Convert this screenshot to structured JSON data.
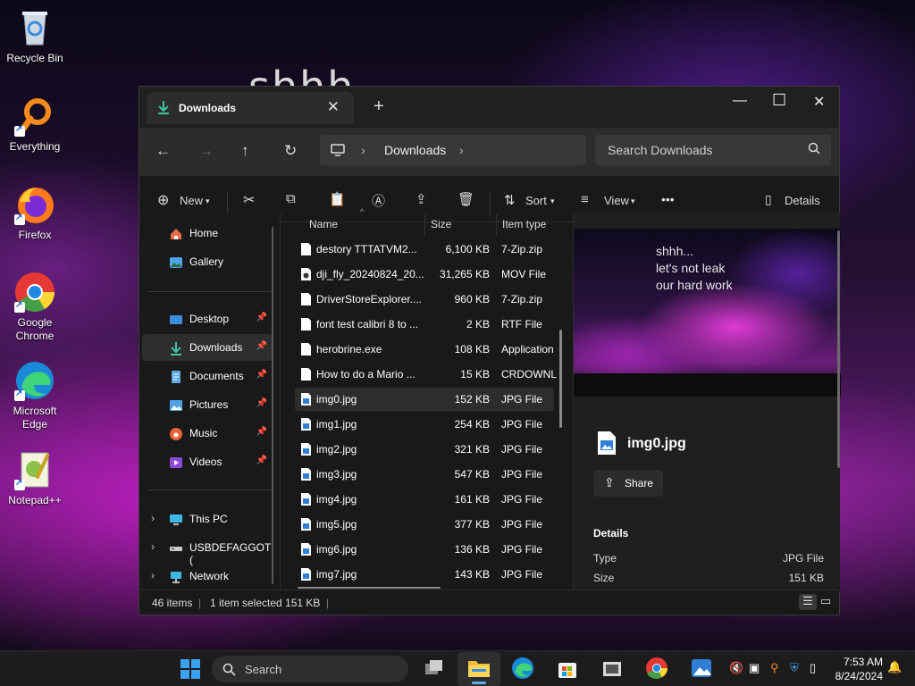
{
  "desktop": {
    "background_text": "shhh",
    "icons": [
      {
        "label": "Recycle Bin",
        "icon": "recycle-bin-icon"
      },
      {
        "label": "Everything",
        "icon": "everything-icon"
      },
      {
        "label": "Firefox",
        "icon": "firefox-icon"
      },
      {
        "label": "Google Chrome",
        "icon": "chrome-icon"
      },
      {
        "label": "Microsoft Edge",
        "icon": "edge-icon"
      },
      {
        "label": "Notepad++",
        "icon": "notepad-plus-plus-icon"
      }
    ]
  },
  "explorer": {
    "tab_title": "Downloads",
    "address": {
      "segments": [
        "Downloads"
      ]
    },
    "search_placeholder": "Search Downloads",
    "toolbar": {
      "new_label": "New",
      "sort_label": "Sort",
      "view_label": "View",
      "details_label": "Details"
    },
    "nav": {
      "items": [
        {
          "label": "Home",
          "icon": "home-icon"
        },
        {
          "label": "Gallery",
          "icon": "gallery-icon"
        },
        {
          "label": "Desktop",
          "icon": "desktop-icon",
          "pinned": true
        },
        {
          "label": "Downloads",
          "icon": "downloads-icon",
          "pinned": true,
          "selected": true
        },
        {
          "label": "Documents",
          "icon": "documents-icon",
          "pinned": true
        },
        {
          "label": "Pictures",
          "icon": "pictures-icon",
          "pinned": true
        },
        {
          "label": "Music",
          "icon": "music-icon",
          "pinned": true
        },
        {
          "label": "Videos",
          "icon": "videos-icon",
          "pinned": true
        },
        {
          "label": "This PC",
          "icon": "this-pc-icon"
        },
        {
          "label": "USBDEFAGGOT (",
          "icon": "usb-drive-icon"
        },
        {
          "label": "Network",
          "icon": "network-icon"
        }
      ]
    },
    "columns": {
      "name": "Name",
      "size": "Size",
      "type": "Item type"
    },
    "files": [
      {
        "name": "destory TTTATVM2...",
        "size": "6,100 KB",
        "type": "7-Zip.zip"
      },
      {
        "name": "dji_fly_20240824_20...",
        "size": "31,265 KB",
        "type": "MOV File"
      },
      {
        "name": "DriverStoreExplorer....",
        "size": "960 KB",
        "type": "7-Zip.zip"
      },
      {
        "name": "font test calibri 8 to ...",
        "size": "2 KB",
        "type": "RTF File"
      },
      {
        "name": "herobrine.exe",
        "size": "108 KB",
        "type": "Application"
      },
      {
        "name": "How to do a Mario ...",
        "size": "15 KB",
        "type": "CRDOWNL"
      },
      {
        "name": "img0.jpg",
        "size": "152 KB",
        "type": "JPG File",
        "selected": true
      },
      {
        "name": "img1.jpg",
        "size": "254 KB",
        "type": "JPG File"
      },
      {
        "name": "img2.jpg",
        "size": "321 KB",
        "type": "JPG File"
      },
      {
        "name": "img3.jpg",
        "size": "547 KB",
        "type": "JPG File"
      },
      {
        "name": "img4.jpg",
        "size": "161 KB",
        "type": "JPG File"
      },
      {
        "name": "img5.jpg",
        "size": "377 KB",
        "type": "JPG File"
      },
      {
        "name": "img6.jpg",
        "size": "136 KB",
        "type": "JPG File"
      },
      {
        "name": "img7.jpg",
        "size": "143 KB",
        "type": "JPG File"
      }
    ],
    "details": {
      "preview_text": [
        "shhh...",
        "let's not leak",
        "our hard work"
      ],
      "file_name": "img0.jpg",
      "share_label": "Share",
      "section_label": "Details",
      "props": [
        {
          "key": "Type",
          "value": "JPG File"
        },
        {
          "key": "Size",
          "value": "151 KB"
        }
      ]
    },
    "status": {
      "items": "46 items",
      "selected": "1 item selected  151 KB"
    }
  },
  "taskbar": {
    "search_placeholder": "Search",
    "time": "7:53 AM",
    "date": "8/24/2024"
  }
}
